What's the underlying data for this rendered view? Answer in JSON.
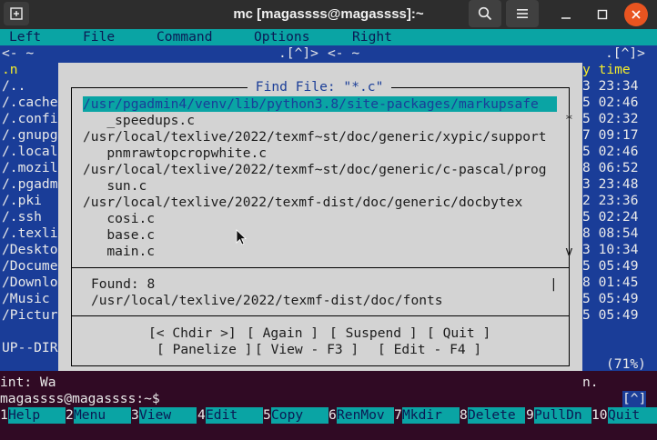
{
  "window": {
    "title": "mc [magassss@magassss]:~"
  },
  "menubar": [
    "Left",
    "File",
    "Command",
    "Options",
    "Right"
  ],
  "left_panel": {
    "header_left": "<- ~",
    "header_right": ".[^]>",
    "col_header": ".n",
    "items": [
      "/..",
      "/.cache",
      "/.config",
      "/.gnupg",
      "/.local",
      "/.mozill",
      "/.pgadm",
      "/.pki",
      "/.ssh",
      "/.texli",
      "/Deskto",
      "/Docume",
      "/Downlo",
      "/Music",
      "/Pictur"
    ],
    "status": "UP--DIR"
  },
  "right_panel": {
    "header_left": "<- ~",
    "header_right": ".[^]>",
    "col_header": "y time",
    "times": [
      "3 23:34",
      "5 02:46",
      "5 02:32",
      "7 09:17",
      "5 02:46",
      "8 06:52",
      "3 23:48",
      "2 23:36",
      "5 02:24",
      "8 08:54",
      "3 10:34",
      "5 05:49",
      "8 01:45",
      "5 05:49",
      "5 05:49"
    ],
    "status": "(71%)"
  },
  "dialog": {
    "title": " Find File: \"*.c\" ",
    "results": [
      "/usr/pgadmin4/venv/lib/python3.8/site-packages/markupsafe",
      "   _speedups.c",
      "/usr/local/texlive/2022/texmf~st/doc/generic/xypic/support",
      "   pnmrawtopcropwhite.c",
      "/usr/local/texlive/2022/texmf~st/doc/generic/c-pascal/prog",
      "   sun.c",
      "/usr/local/texlive/2022/texmf-dist/doc/generic/docbytex",
      "   cosi.c",
      "   base.c",
      "   main.c"
    ],
    "scroll_top": "*",
    "scroll_bottom": "v",
    "found": "Found: 8",
    "spinner": "|",
    "current_dir": "/usr/local/texlive/2022/texmf-dist/doc/fonts",
    "buttons_row1": {
      "chdir": "[< Chdir >]",
      "again": "[ Again ]",
      "suspend": "[ Suspend ]",
      "quit": "[ Quit ]"
    },
    "buttons_row2": {
      "panelize": "[ Panelize ]",
      "view": "[ View - F3 ]",
      "edit": "[ Edit - F4 ]"
    }
  },
  "hint": {
    "left": "int: Wa",
    "right": "n."
  },
  "prompt": {
    "text": "magassss@magassss:~$",
    "history_btn": "[^]"
  },
  "fkeys": [
    {
      "n": "1",
      "label": "Help"
    },
    {
      "n": "2",
      "label": "Menu"
    },
    {
      "n": "3",
      "label": "View"
    },
    {
      "n": "4",
      "label": "Edit"
    },
    {
      "n": "5",
      "label": "Copy"
    },
    {
      "n": "6",
      "label": "RenMov"
    },
    {
      "n": "7",
      "label": "Mkdir"
    },
    {
      "n": "8",
      "label": "Delete"
    },
    {
      "n": "9",
      "label": "PullDn"
    },
    {
      "n": "10",
      "label": "Quit"
    }
  ]
}
